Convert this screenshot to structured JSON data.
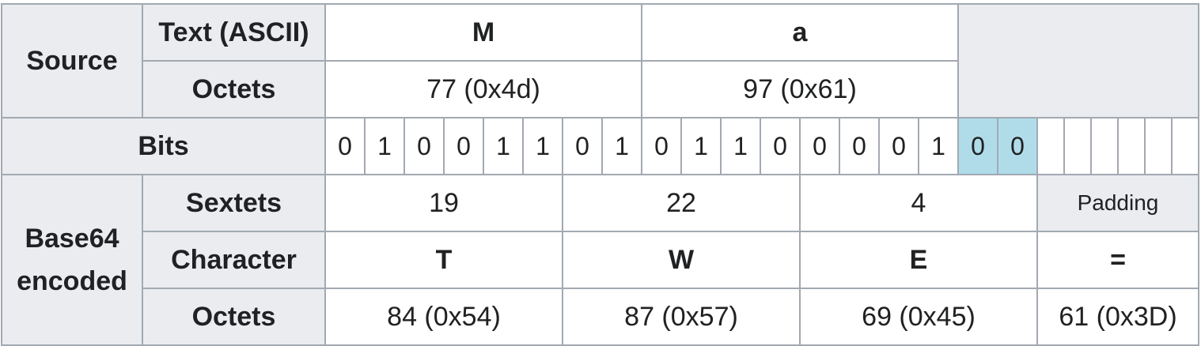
{
  "table": {
    "source": {
      "label": "Source",
      "text_label": "Text (ASCII)",
      "octets_label": "Octets",
      "chars": [
        "M",
        "a"
      ],
      "octets": [
        "77 (0x4d)",
        "97 (0x61)"
      ]
    },
    "bits": {
      "label": "Bits",
      "values": [
        "0",
        "1",
        "0",
        "0",
        "1",
        "1",
        "0",
        "1",
        "0",
        "1",
        "1",
        "0",
        "0",
        "0",
        "0",
        "1",
        "0",
        "0"
      ],
      "highlighted_indices": [
        16,
        17
      ],
      "highlight_color": "#b0dcea",
      "empty_count": 6
    },
    "encoded": {
      "label_line1": "Base64",
      "label_line2": "encoded",
      "sextets_label": "Sextets",
      "character_label": "Character",
      "octets_label": "Octets",
      "sextets": [
        "19",
        "22",
        "4"
      ],
      "padding_label": "Padding",
      "characters": [
        "T",
        "W",
        "E",
        "="
      ],
      "octets": [
        "84 (0x54)",
        "87 (0x57)",
        "69 (0x45)",
        "61 (0x3D)"
      ]
    },
    "colors": {
      "header_bg": "#eaecf0",
      "border": "#a2a9b1",
      "text": "#202122"
    }
  }
}
